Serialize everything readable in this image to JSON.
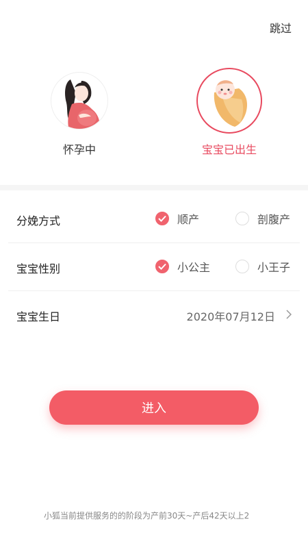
{
  "header": {
    "skip_label": "跳过"
  },
  "stages": [
    {
      "label": "怀孕中",
      "icon": "pregnant-woman-icon",
      "selected": false
    },
    {
      "label": "宝宝已出生",
      "icon": "swaddled-baby-icon",
      "selected": true
    }
  ],
  "form": {
    "delivery": {
      "label": "分娩方式",
      "options": [
        {
          "label": "顺产",
          "checked": true
        },
        {
          "label": "剖腹产",
          "checked": false
        }
      ]
    },
    "gender": {
      "label": "宝宝性别",
      "options": [
        {
          "label": "小公主",
          "checked": true
        },
        {
          "label": "小王子",
          "checked": false
        }
      ]
    },
    "birthday": {
      "label": "宝宝生日",
      "value": "2020年07月12日"
    }
  },
  "enter_label": "进入",
  "footer_note": "小狐当前提供服务的的阶段为产前30天~产后42天以上2"
}
